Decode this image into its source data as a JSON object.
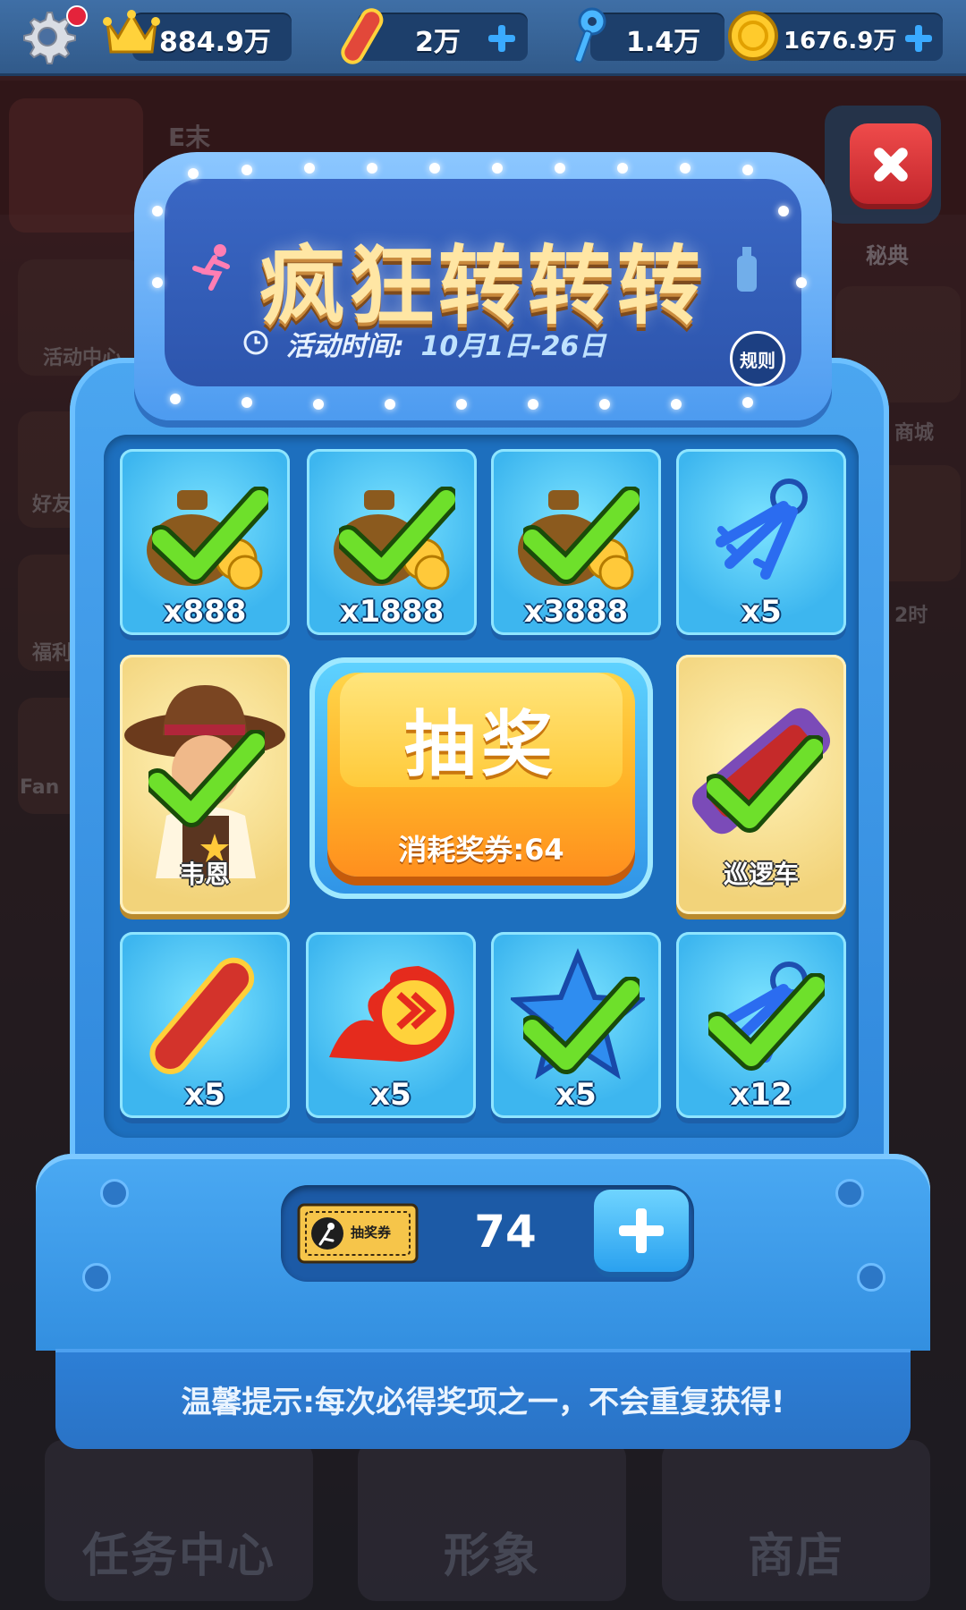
{
  "topbar": {
    "trophy_value": "884.9万",
    "board_value": "2万",
    "key_value": "1.4万",
    "coin_value": "1676.9万"
  },
  "background": {
    "player_name": "E末",
    "side_left": [
      "活动中心",
      "好友",
      "福利",
      "Fan"
    ],
    "side_right": [
      "秘典",
      "商城",
      "2时"
    ],
    "bottom_nav": [
      "任务中心",
      "形象",
      "商店"
    ]
  },
  "event": {
    "title": "疯狂转转转",
    "time_label": "活动时间:",
    "time_value": "10月1日-26日",
    "rules_label": "规则"
  },
  "prizes": [
    {
      "label": "x888",
      "icon": "coin-bag-icon",
      "claimed": true
    },
    {
      "label": "x1888",
      "icon": "coin-bag-icon",
      "claimed": true
    },
    {
      "label": "x3888",
      "icon": "coin-bag-icon",
      "claimed": true
    },
    {
      "label": "x5",
      "icon": "key-bundle-icon",
      "claimed": false
    },
    {
      "label": "韦恩",
      "icon": "cowboy-character-icon",
      "claimed": true
    },
    {
      "label": "巡逻车",
      "icon": "hoverboard-icon",
      "claimed": true
    },
    {
      "label": "x5",
      "icon": "red-board-icon",
      "claimed": false
    },
    {
      "label": "x5",
      "icon": "fire-boost-icon",
      "claimed": false
    },
    {
      "label": "x5",
      "icon": "blue-star-icon",
      "claimed": true
    },
    {
      "label": "x12",
      "icon": "key-bundle-icon",
      "claimed": true
    }
  ],
  "draw": {
    "label": "抽奖",
    "cost": "消耗奖券:64"
  },
  "tickets": {
    "icon_text": "抽奖券",
    "count": "74"
  },
  "tip": "温馨提示:每次必得奖项之一，不会重复获得!",
  "colors": {
    "accent_blue": "#3088dc",
    "gold": "#ffb227",
    "check_green": "#6ee02b"
  }
}
